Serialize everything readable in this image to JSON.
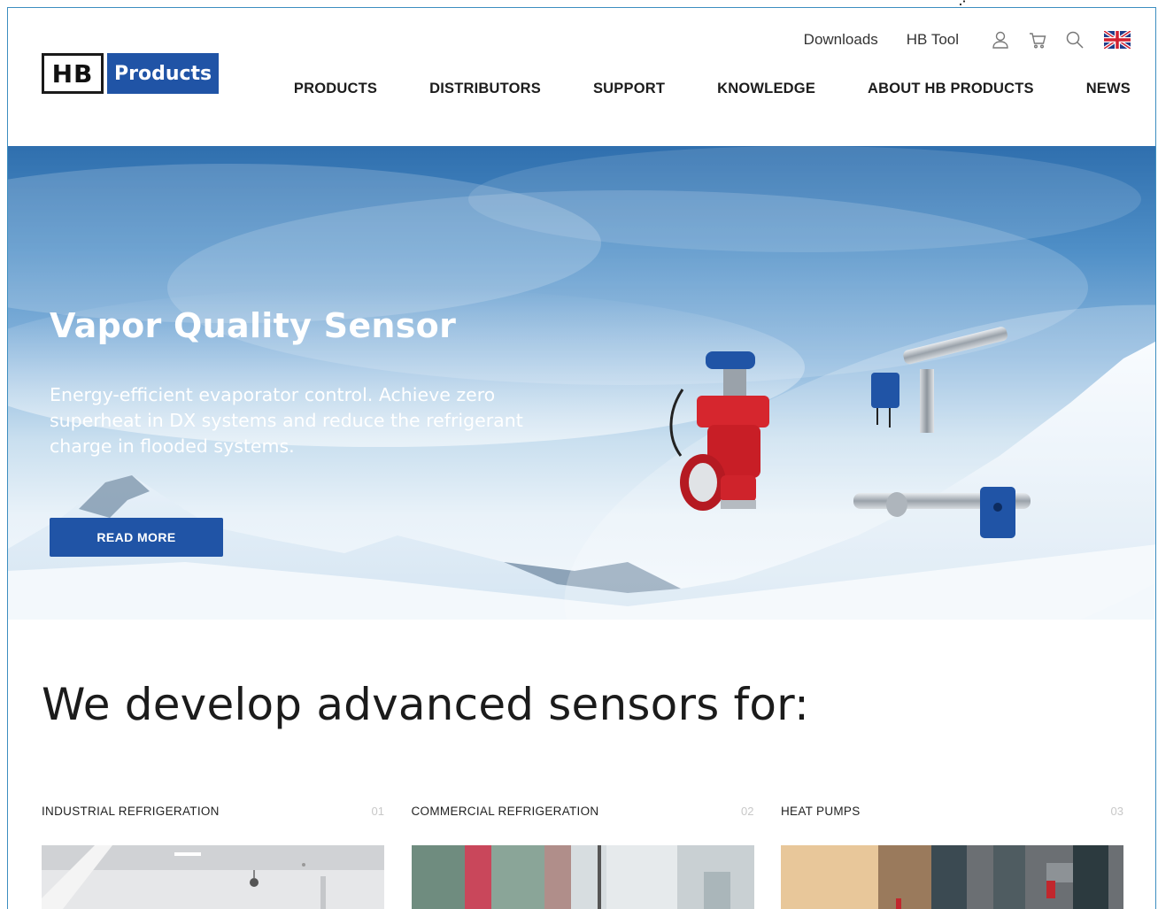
{
  "header": {
    "logo": {
      "left": "HB",
      "right": "Products"
    },
    "utility_links": [
      "Downloads",
      "HB Tool"
    ],
    "icons": [
      "user-icon",
      "cart-icon",
      "search-icon",
      "uk-flag-icon"
    ],
    "nav": [
      "PRODUCTS",
      "DISTRIBUTORS",
      "SUPPORT",
      "KNOWLEDGE",
      "ABOUT HB PRODUCTS",
      "NEWS"
    ]
  },
  "hero": {
    "title": "Vapor Quality Sensor",
    "text": "Energy-efficient evaporator control. Achieve zero superheat in DX systems and reduce the refrigerant charge in flooded systems.",
    "button": "READ MORE"
  },
  "intro": {
    "title": "We develop advanced sensors for:"
  },
  "categories": [
    {
      "label": "INDUSTRIAL REFRIGERATION",
      "num": "01"
    },
    {
      "label": "COMMERCIAL REFRIGERATION",
      "num": "02"
    },
    {
      "label": "HEAT PUMPS",
      "num": "03"
    }
  ],
  "colors": {
    "brand_blue": "#2054a6",
    "frame_border": "#3d8ec0"
  }
}
